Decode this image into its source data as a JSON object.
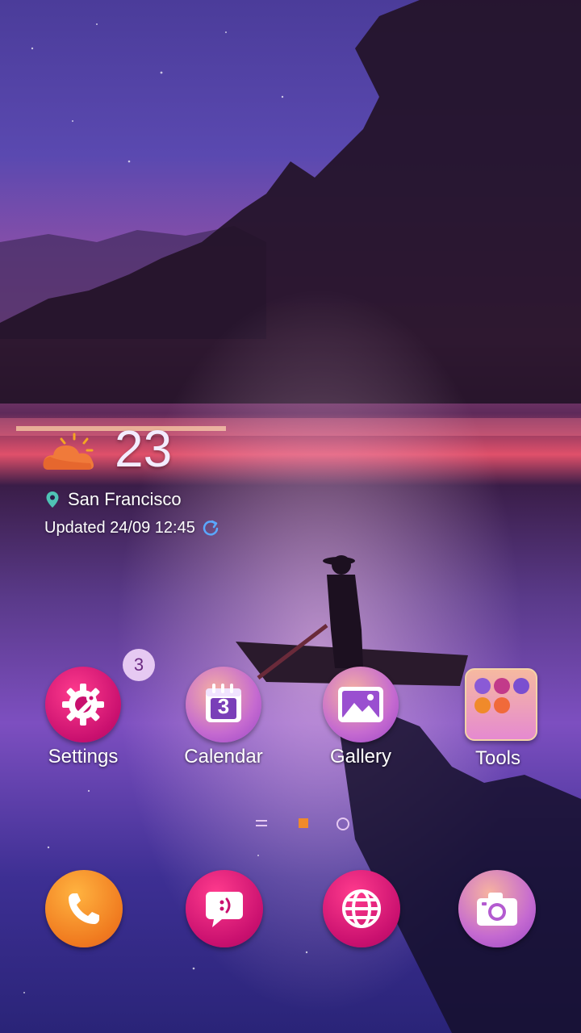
{
  "weather": {
    "temperature": "23",
    "city": "San Francisco",
    "updated": "Updated 24/09 12:45",
    "icons": {
      "condition": "partly-cloudy-icon",
      "location": "location-pin-icon",
      "refresh": "refresh-icon"
    }
  },
  "apps": [
    {
      "label": "Settings",
      "icon": "settings-gear-icon",
      "badge": "3"
    },
    {
      "label": "Calendar",
      "icon": "calendar-icon",
      "calendar_day": "3"
    },
    {
      "label": "Gallery",
      "icon": "gallery-icon"
    },
    {
      "label": "Tools",
      "icon": "folder-icon"
    }
  ],
  "pager": {
    "pages": 3,
    "current": 2
  },
  "dock": [
    {
      "icon": "phone-icon"
    },
    {
      "icon": "messages-icon"
    },
    {
      "icon": "browser-globe-icon"
    },
    {
      "icon": "camera-icon"
    }
  ],
  "colors": {
    "accent_orange": "#f0822a",
    "accent_magenta": "#c8137c",
    "accent_purple": "#8f3bd6",
    "badge_bg": "#e6c9f2"
  }
}
